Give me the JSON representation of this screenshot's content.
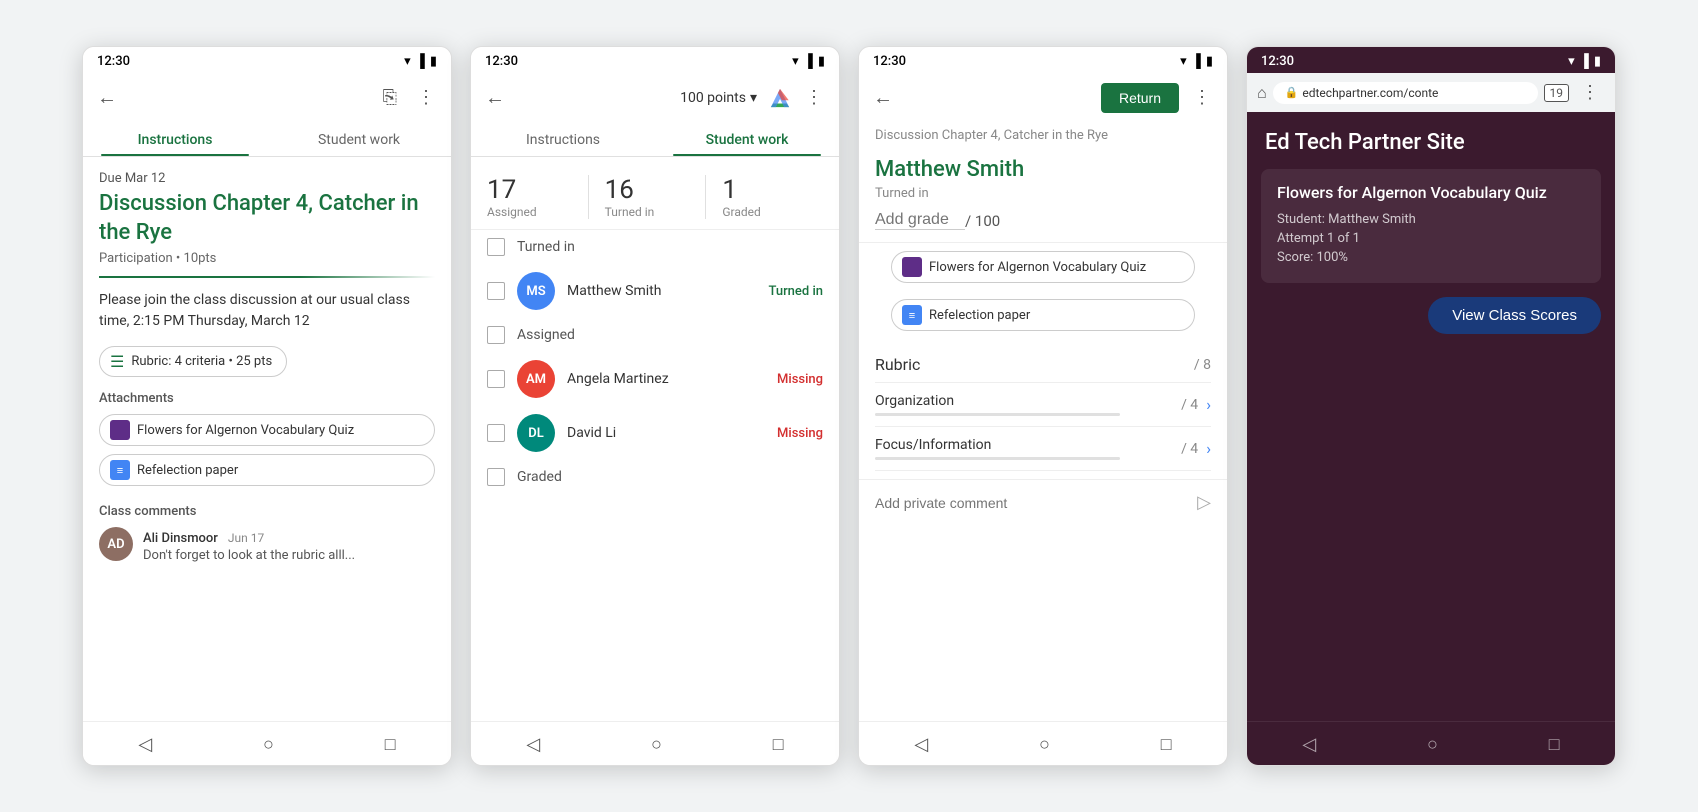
{
  "screen1": {
    "status_time": "12:30",
    "back_label": "←",
    "tab_instructions": "Instructions",
    "tab_student_work": "Student work",
    "due_date": "Due Mar 12",
    "assignment_title": "Discussion Chapter 4, Catcher in the Rye",
    "assignment_meta": "Participation • 10pts",
    "description": "Please join the class discussion at our usual class time, 2:15 PM Thursday, March 12",
    "rubric_label": "Rubric: 4 criteria • 25 pts",
    "attachments_label": "Attachments",
    "attachment1": "Flowers for Algernon Vocabulary Quiz",
    "attachment2": "Refelection paper",
    "class_comments_label": "Class comments",
    "commenter": "Ali Dinsmoor",
    "comment_date": "Jun 17",
    "comment_text": "Don't forget to look at the rubric alll..."
  },
  "screen2": {
    "status_time": "12:30",
    "tab_instructions": "Instructions",
    "tab_student_work": "Student work",
    "points_label": "100 points",
    "stat_assigned_num": "17",
    "stat_assigned_label": "Assigned",
    "stat_turned_num": "16",
    "stat_turned_label": "Turned in",
    "stat_graded_num": "1",
    "stat_graded_label": "Graded",
    "section_turned_in": "Turned in",
    "student1_name": "Matthew Smith",
    "student1_status": "Turned in",
    "section_assigned": "Assigned",
    "student2_name": "Angela Martinez",
    "student2_status": "Missing",
    "student3_name": "David Li",
    "student3_status": "Missing",
    "section_graded": "Graded"
  },
  "screen3": {
    "status_time": "12:30",
    "return_btn": "Return",
    "student_name": "Matthew Smith",
    "turned_in_label": "Turned in",
    "add_grade_placeholder": "Add grade",
    "grade_of": "/ 100",
    "attachment1": "Flowers for Algernon Vocabulary Quiz",
    "attachment2": "Refelection paper",
    "rubric_label": "Rubric",
    "rubric_of": "/ 8",
    "criterion1_name": "Organization",
    "criterion1_of": "/ 4",
    "criterion2_name": "Focus/Information",
    "criterion2_of": "/ 4",
    "add_private_comment": "Add private comment"
  },
  "screen4": {
    "status_time": "12:30",
    "url": "edtechpartner.com/conte",
    "tab_count": "19",
    "site_title": "Ed Tech Partner Site",
    "quiz_title": "Flowers for Algernon Vocabulary Quiz",
    "student_label": "Student: Matthew Smith",
    "attempt_label": "Attempt 1 of 1",
    "score_label": "Score: 100%",
    "view_scores_btn": "View Class Scores"
  }
}
